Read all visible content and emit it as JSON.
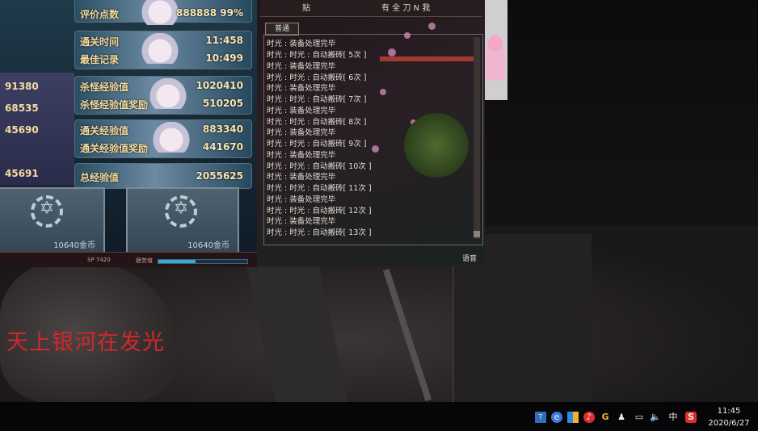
{
  "desktop": {
    "lyric": "天上银河在发光"
  },
  "game": {
    "stats": [
      {
        "label": "评价点数",
        "value": "888888 99%"
      },
      {
        "label": "通关时间",
        "value": "11:458"
      },
      {
        "label": "最佳记录",
        "value": "10:499"
      },
      {
        "label": "杀怪经验值",
        "value": "1020410"
      },
      {
        "label": "杀怪经验值奖励",
        "value": "510205"
      },
      {
        "label": "通关经验值",
        "value": "883340"
      },
      {
        "label": "通关经验值奖励",
        "value": "441670"
      },
      {
        "label": "总经验值",
        "value": "2055625"
      }
    ],
    "left_values": [
      "91380",
      "68535",
      "45690",
      "45691"
    ],
    "cards": [
      {
        "price": "10640金币"
      },
      {
        "price": "10640金币"
      }
    ],
    "hud": {
      "sp": "SP 7420",
      "fatigue_label": "疲劳值",
      "fatigue_fraction": 0.42
    }
  },
  "chat": {
    "top_text": "贴",
    "top_right_text": "有 全 刀 N 我",
    "tab_label": "普通",
    "lines": [
      "时光 : 装备处理完毕",
      "时光 : 时光 : 自动搬砖[ 5次 ]",
      "时光 : 装备处理完毕",
      "时光 : 时光 : 自动搬砖[ 6次 ]",
      "时光 : 装备处理完毕",
      "时光 : 时光 : 自动搬砖[ 7次 ]",
      "时光 : 装备处理完毕",
      "时光 : 时光 : 自动搬砖[ 8次 ]",
      "时光 : 装备处理完毕",
      "时光 : 时光 : 自动搬砖[ 9次 ]",
      "时光 : 装备处理完毕",
      "时光 : 时光 : 自动搬砖[ 10次 ]",
      "时光 : 装备处理完毕",
      "时光 : 时光 : 自动搬砖[ 11次 ]",
      "时光 : 装备处理完毕",
      "时光 : 时光 : 自动搬砖[ 12次 ]",
      "时光 : 装备处理完毕",
      "时光 : 时光 : 自动搬砖[ 13次 ]"
    ],
    "footer": "语音"
  },
  "taskbar": {
    "ime": "中",
    "time": "11:45",
    "date": "2020/6/27",
    "colors": {
      "sogou": "#e0302a",
      "ime_text": "#ffffff"
    }
  }
}
